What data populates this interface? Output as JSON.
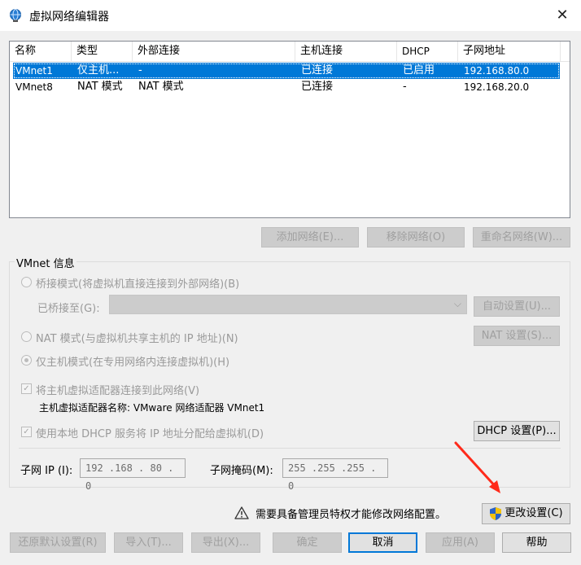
{
  "window": {
    "title": "虚拟网络编辑器",
    "close": "✕"
  },
  "table": {
    "headers": [
      "名称",
      "类型",
      "外部连接",
      "主机连接",
      "DHCP",
      "子网地址"
    ],
    "rows": [
      {
        "name": "VMnet1",
        "type": "仅主机...",
        "external": "-",
        "host": "已连接",
        "dhcp": "已启用",
        "subnet": "192.168.80.0",
        "selected": true
      },
      {
        "name": "VMnet8",
        "type": "NAT 模式",
        "external": "NAT 模式",
        "host": "已连接",
        "dhcp": "-",
        "subnet": "192.168.20.0",
        "selected": false
      }
    ]
  },
  "list_buttons": {
    "add": "添加网络(E)...",
    "remove": "移除网络(O)",
    "rename": "重命名网络(W)..."
  },
  "vmnet_info": {
    "group_title": "VMnet 信息",
    "bridged_label": "桥接模式(将虚拟机直接连接到外部网络)(B)",
    "bridged_to_label": "已桥接至(G):",
    "bridged_to_value": "",
    "auto_settings": "自动设置(U)...",
    "nat_label": "NAT 模式(与虚拟机共享主机的 IP 地址)(N)",
    "nat_settings": "NAT 设置(S)...",
    "hostonly_label": "仅主机模式(在专用网络内连接虚拟机)(H)",
    "connect_adapter_label": "将主机虚拟适配器连接到此网络(V)",
    "adapter_name_label": "主机虚拟适配器名称: VMware 网络适配器 VMnet1",
    "dhcp_label": "使用本地 DHCP 服务将 IP 地址分配给虚拟机(D)",
    "dhcp_settings": "DHCP 设置(P)...",
    "subnet_ip_label": "子网 IP (I):",
    "subnet_ip_value": "192 .168 . 80 . 0",
    "subnet_mask_label": "子网掩码(M):",
    "subnet_mask_value": "255 .255 .255 . 0"
  },
  "admin": {
    "warning": "需要具备管理员特权才能修改网络配置。",
    "change_settings": "更改设置(C)"
  },
  "footer": {
    "restore": "还原默认设置(R)",
    "import": "导入(T)...",
    "export": "导出(X)...",
    "ok": "确定",
    "cancel": "取消",
    "apply": "应用(A)",
    "help": "帮助"
  },
  "colors": {
    "selection": "#0078d7",
    "annotation_arrow": "#ff2a1a"
  }
}
